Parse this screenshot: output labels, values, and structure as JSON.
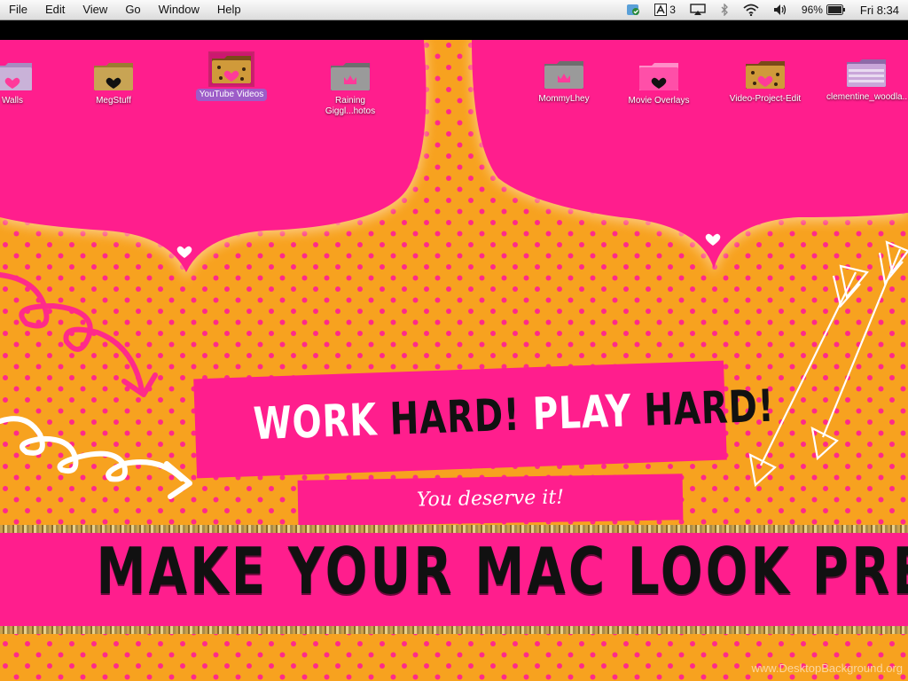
{
  "menubar": {
    "menus": [
      "File",
      "Edit",
      "View",
      "Go",
      "Window",
      "Help"
    ],
    "status": {
      "notification_count": "3",
      "battery": "96%",
      "clock": "Fri 8:34"
    }
  },
  "desktop": {
    "icons": [
      {
        "label": "Walls",
        "style": "lilac-heart"
      },
      {
        "label": "MegStuff",
        "style": "glitter-heart"
      },
      {
        "label": "YouTube Videos",
        "style": "leopard-heart",
        "selected": true
      },
      {
        "label": "Raining Giggl...hotos",
        "style": "gray-crown"
      },
      {
        "label": "MommyLhey",
        "style": "gray-crown"
      },
      {
        "label": "Movie Overlays",
        "style": "pink-heart"
      },
      {
        "label": "Video-Project-Edit",
        "style": "leopard-heart"
      },
      {
        "label": "clementine_woodla...psters",
        "style": "lilac-stripes"
      }
    ]
  },
  "wallpaper": {
    "headline_white_1": "WORK",
    "headline_black_1": "HARD!",
    "headline_white_2": "PLAY",
    "headline_black_2": "HARD!",
    "subline": "You deserve it!",
    "bottom_text": "MAKE YOUR MAC LOOK PRETTY!!!",
    "watermark": "www.DesktopBackground.org",
    "colors": {
      "orange": "#f7a21f",
      "pink": "#ff1e8d",
      "dot": "#ff2a8a",
      "black": "#111111"
    }
  }
}
